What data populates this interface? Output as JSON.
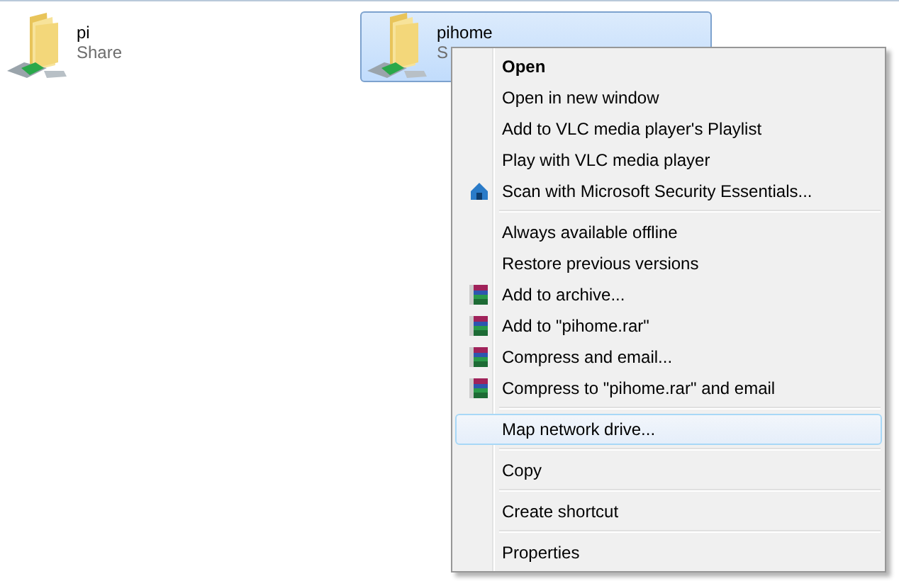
{
  "folders": [
    {
      "name": "pi",
      "subtitle": "Share",
      "selected": false
    },
    {
      "name": "pihome",
      "subtitle": "S",
      "selected": true
    }
  ],
  "context_menu": {
    "items": [
      {
        "kind": "item",
        "label": "Open",
        "default": true,
        "selected": false
      },
      {
        "kind": "item",
        "label": "Open in new window",
        "default": false,
        "selected": false
      },
      {
        "kind": "item",
        "label": "Add to VLC media player's Playlist",
        "default": false,
        "selected": false
      },
      {
        "kind": "item",
        "label": "Play with VLC media player",
        "default": false,
        "selected": false
      },
      {
        "kind": "scan",
        "label": "Scan with Microsoft Security Essentials...",
        "default": false,
        "selected": false
      },
      {
        "kind": "separator"
      },
      {
        "kind": "item",
        "label": "Always available offline",
        "default": false,
        "selected": false
      },
      {
        "kind": "item",
        "label": "Restore previous versions",
        "default": false,
        "selected": false
      },
      {
        "kind": "archive",
        "label": "Add to archive...",
        "default": false,
        "selected": false
      },
      {
        "kind": "archive",
        "label": "Add to \"pihome.rar\"",
        "default": false,
        "selected": false
      },
      {
        "kind": "archive",
        "label": "Compress and email...",
        "default": false,
        "selected": false
      },
      {
        "kind": "archive",
        "label": "Compress to \"pihome.rar\" and email",
        "default": false,
        "selected": false
      },
      {
        "kind": "separator"
      },
      {
        "kind": "item",
        "label": "Map network drive...",
        "default": false,
        "selected": true
      },
      {
        "kind": "separator"
      },
      {
        "kind": "item",
        "label": "Copy",
        "default": false,
        "selected": false
      },
      {
        "kind": "separator"
      },
      {
        "kind": "item",
        "label": "Create shortcut",
        "default": false,
        "selected": false
      },
      {
        "kind": "separator"
      },
      {
        "kind": "item",
        "label": "Properties",
        "default": false,
        "selected": false
      }
    ]
  }
}
